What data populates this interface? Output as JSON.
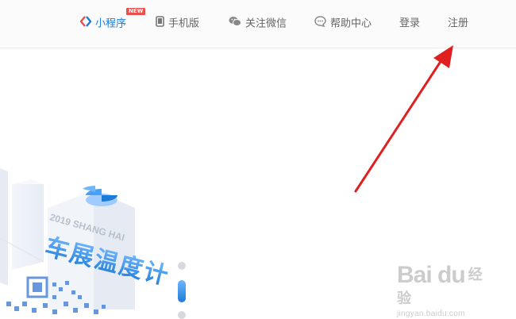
{
  "header": {
    "nav": [
      {
        "label": "小程序",
        "badge": "NEW",
        "icon": "mini-program-icon",
        "active": true
      },
      {
        "label": "手机版",
        "icon": "phone-icon"
      },
      {
        "label": "关注微信",
        "icon": "wechat-icon"
      },
      {
        "label": "帮助中心",
        "icon": "help-chat-icon"
      },
      {
        "label": "登录"
      },
      {
        "label": "注册"
      }
    ]
  },
  "banner": {
    "year_line": "2019 SHANG HAI",
    "title_art": "车展温度计"
  },
  "carousel": {
    "dots": 3,
    "active_index": 1
  },
  "watermark": {
    "logo": "Bai du",
    "logo_cn": "经验",
    "url": "jingyan.baidu.com"
  },
  "colors": {
    "accent": "#1d7bd8",
    "badge": "#e84f4f",
    "annotation_arrow": "#e02020",
    "nav_text": "#666666"
  }
}
